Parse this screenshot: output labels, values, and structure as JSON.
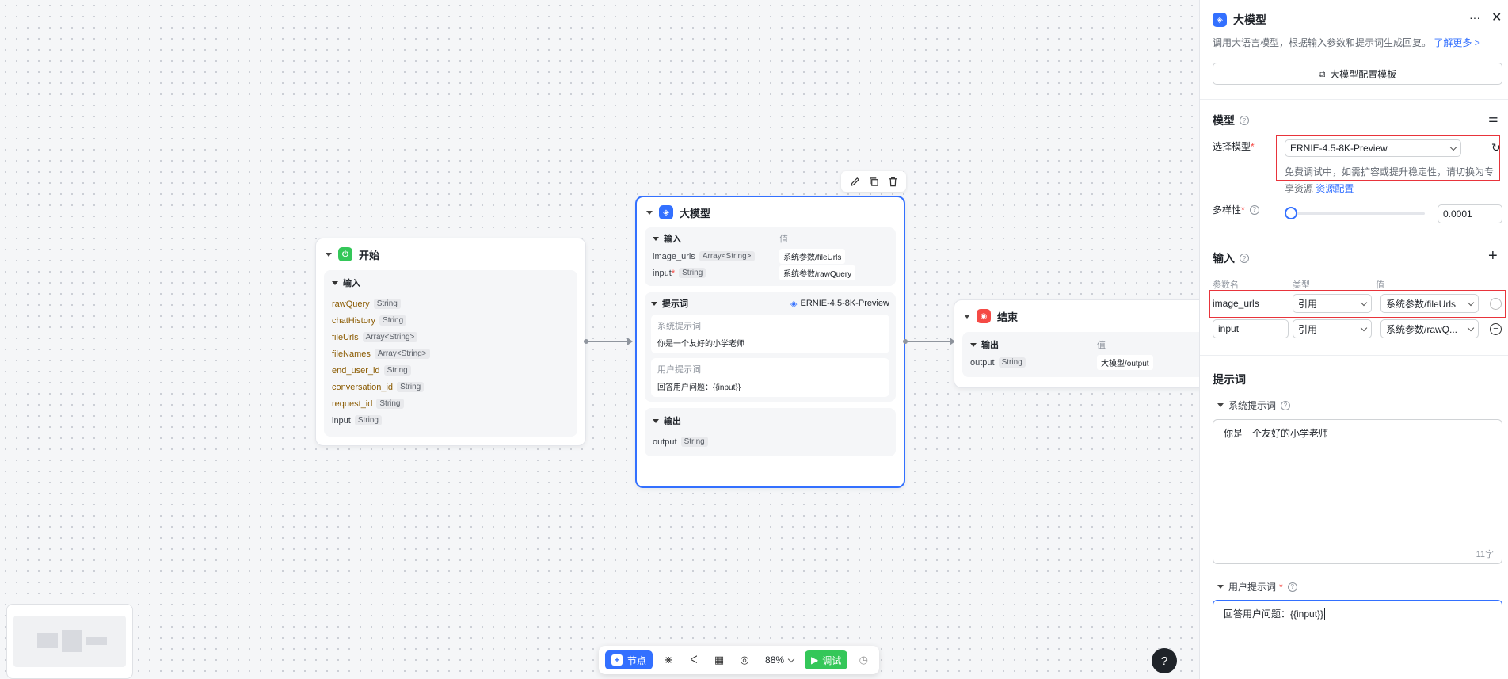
{
  "canvas": {
    "start_node": {
      "title": "开始",
      "section": "输入",
      "params": [
        {
          "name": "rawQuery",
          "type": "String"
        },
        {
          "name": "chatHistory",
          "type": "String"
        },
        {
          "name": "fileUrls",
          "type": "Array<String>"
        },
        {
          "name": "fileNames",
          "type": "Array<String>"
        },
        {
          "name": "end_user_id",
          "type": "String"
        },
        {
          "name": "conversation_id",
          "type": "String"
        },
        {
          "name": "request_id",
          "type": "String"
        },
        {
          "name": "input",
          "type": "String"
        }
      ]
    },
    "llm_node": {
      "title": "大模型",
      "input_section": "输入",
      "value_header": "值",
      "inputs": [
        {
          "name": "image_urls",
          "type": "Array<String>",
          "value": "系统参数/fileUrls",
          "required": ""
        },
        {
          "name": "input",
          "type": "String",
          "value": "系统参数/rawQuery",
          "required": "*"
        }
      ],
      "prompt_section": "提示词",
      "model_name": "ERNIE-4.5-8K-Preview",
      "system_prompt_label": "系统提示词",
      "system_prompt": "你是一个友好的小学老师",
      "user_prompt_label": "用户提示词",
      "user_prompt": "回答用户问题：{{input}}",
      "output_section": "输出",
      "output": {
        "name": "output",
        "type": "String"
      }
    },
    "end_node": {
      "title": "结束",
      "section": "输出",
      "value_header": "值",
      "output": {
        "name": "output",
        "type": "String",
        "value": "大模型/output"
      }
    },
    "toolbar": {
      "add_node": "节点",
      "zoom": "88%",
      "debug": "调试"
    },
    "help": "?"
  },
  "panel": {
    "title": "大模型",
    "description": "调用大语言模型，根据输入参数和提示词生成回复。",
    "learn_more": "了解更多 >",
    "config_template": "大模型配置模板",
    "model_section": "模型",
    "select_model_label": "选择模型",
    "selected_model": "ERNIE-4.5-8K-Preview",
    "model_hint": "免费调试中，如需扩容或提升稳定性，请切换为专",
    "model_hint_2": "享资源",
    "resource_link": "资源配置",
    "diversity_label": "多样性",
    "diversity_value": "0.0001",
    "diversity_fraction": 0.0,
    "input_section": "输入",
    "col_name": "参数名",
    "col_type": "类型",
    "col_value": "值",
    "inputs": [
      {
        "name": "image_urls",
        "type": "引用",
        "value": "系统参数/fileUrls"
      },
      {
        "name": "input",
        "type": "引用",
        "value": "系统参数/rawQ..."
      }
    ],
    "prompt_section": "提示词",
    "system_prompt_label": "系统提示词",
    "system_prompt": "你是一个友好的小学老师",
    "char_count": "11字",
    "user_prompt_label": "用户提示词",
    "user_prompt": "回答用户问题：{{input}}"
  }
}
